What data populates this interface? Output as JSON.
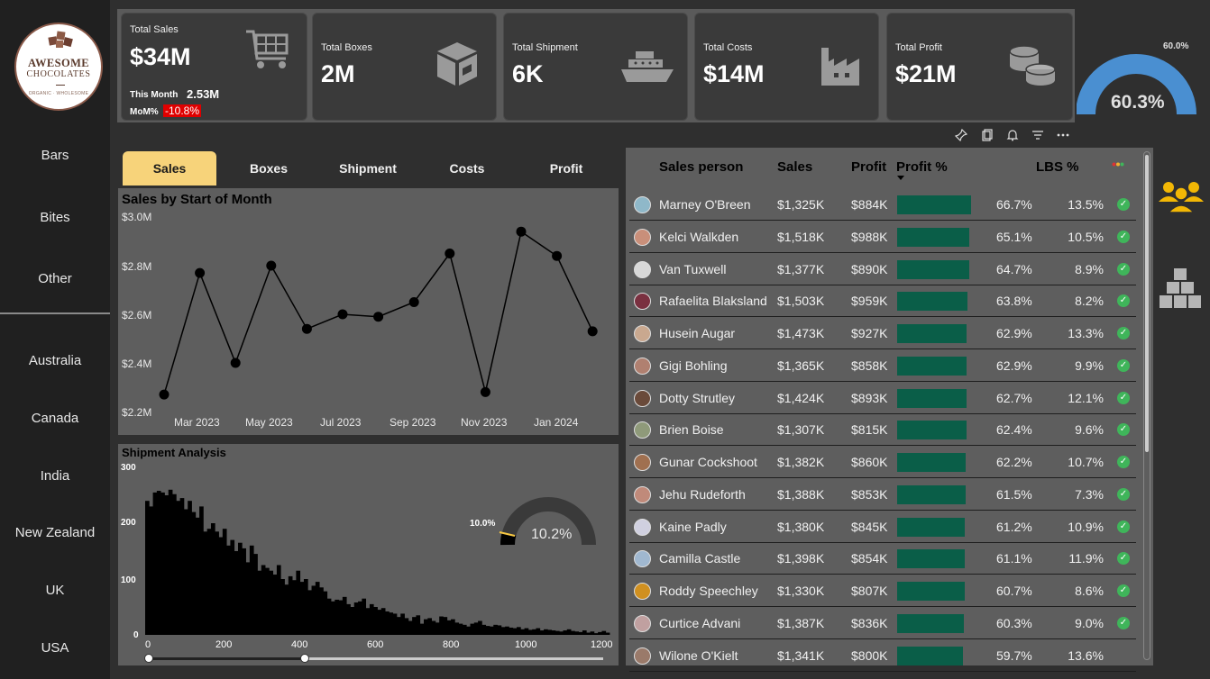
{
  "logo": {
    "line1": "AWESOME",
    "line2": "CHOCOLATES",
    "line3": "ORGANIC · WHOLESOME"
  },
  "sidebar": {
    "products": [
      "Bars",
      "Bites",
      "Other"
    ],
    "countries": [
      "Australia",
      "Canada",
      "India",
      "New Zealand",
      "UK",
      "USA"
    ]
  },
  "kpis": {
    "sales": {
      "title": "Total Sales",
      "value": "$34M",
      "this_month_label": "This Month",
      "this_month_value": "2.53M",
      "mom_label": "MoM%",
      "mom_value": "-10.8%"
    },
    "boxes": {
      "title": "Total Boxes",
      "value": "2M"
    },
    "shipment": {
      "title": "Total Shipment",
      "value": "6K"
    },
    "costs": {
      "title": "Total Costs",
      "value": "$14M"
    },
    "profit": {
      "title": "Total Profit",
      "value": "$21M"
    }
  },
  "profit_gauge": {
    "target_label": "60.0%",
    "value_label": "60.3%",
    "value": 60.3,
    "target": 60.0,
    "color": "#4a8fd1"
  },
  "tabs": [
    "Sales",
    "Boxes",
    "Shipment",
    "Costs",
    "Profit"
  ],
  "active_tab": "Sales",
  "line_chart": {
    "title": "Sales by Start of Month",
    "y_ticks": [
      "$3.0M",
      "$2.8M",
      "$2.6M",
      "$2.4M",
      "$2.2M"
    ],
    "x_ticks": [
      "Mar 2023",
      "May 2023",
      "Jul 2023",
      "Sep 2023",
      "Nov 2023",
      "Jan 2024"
    ]
  },
  "shipment_chart": {
    "title": "Shipment Analysis",
    "y_ticks": [
      "300",
      "200",
      "100",
      "0"
    ],
    "x_ticks": [
      "0",
      "200",
      "400",
      "600",
      "800",
      "1000",
      "1200"
    ],
    "gauge_target_label": "10.0%",
    "gauge_value_label": "10.2%"
  },
  "chart_data": [
    {
      "type": "line",
      "title": "Sales by Start of Month",
      "x": [
        "2023-02",
        "2023-03",
        "2023-04",
        "2023-05",
        "2023-06",
        "2023-07",
        "2023-08",
        "2023-09",
        "2023-10",
        "2023-11",
        "2023-12",
        "2024-01",
        "2024-02"
      ],
      "y": [
        2.27,
        2.77,
        2.4,
        2.8,
        2.54,
        2.6,
        2.59,
        2.65,
        2.85,
        2.28,
        2.94,
        2.84,
        2.53
      ],
      "ylim": [
        2.2,
        3.0
      ],
      "y_unit": "$M",
      "color": "#000000"
    },
    {
      "type": "bar",
      "title": "Shipment Analysis",
      "bin_width": 10,
      "x_range": [
        0,
        1200
      ],
      "ylim": [
        0,
        300
      ],
      "values": [
        240,
        230,
        255,
        258,
        255,
        250,
        260,
        252,
        240,
        245,
        225,
        240,
        220,
        210,
        230,
        185,
        190,
        200,
        185,
        175,
        190,
        160,
        170,
        150,
        165,
        155,
        130,
        160,
        145,
        115,
        125,
        120,
        115,
        108,
        125,
        100,
        90,
        105,
        98,
        115,
        95,
        100,
        80,
        88,
        95,
        85,
        78,
        65,
        60,
        63,
        62,
        68,
        55,
        50,
        58,
        60,
        65,
        48,
        55,
        50,
        45,
        48,
        42,
        40,
        38,
        32,
        38,
        30,
        25,
        32,
        35,
        20,
        28,
        30,
        25,
        22,
        33,
        32,
        26,
        28,
        22,
        20,
        18,
        15,
        20,
        22,
        25,
        18,
        16,
        15,
        18,
        17,
        14,
        15,
        13,
        12,
        14,
        10,
        12,
        9,
        10,
        12,
        8,
        10,
        9,
        8,
        7,
        6,
        8,
        10,
        7,
        6,
        5,
        8,
        4,
        6,
        3,
        5,
        7,
        4
      ],
      "color": "#000000"
    },
    {
      "type": "table",
      "columns": [
        "Sales person",
        "Sales",
        "Profit",
        "Profit %",
        "LBS %"
      ],
      "rows": [
        [
          "Marney O'Breen",
          "$1,325K",
          "$884K",
          "66.7%",
          "13.5%"
        ],
        [
          "Kelci Walkden",
          "$1,518K",
          "$988K",
          "65.1%",
          "10.5%"
        ],
        [
          "Van Tuxwell",
          "$1,377K",
          "$890K",
          "64.7%",
          "8.9%"
        ],
        [
          "Rafaelita Blaksland",
          "$1,503K",
          "$959K",
          "63.8%",
          "8.2%"
        ],
        [
          "Husein Augar",
          "$1,473K",
          "$927K",
          "62.9%",
          "13.3%"
        ],
        [
          "Gigi Bohling",
          "$1,365K",
          "$858K",
          "62.9%",
          "9.9%"
        ],
        [
          "Dotty Strutley",
          "$1,424K",
          "$893K",
          "62.7%",
          "12.1%"
        ],
        [
          "Brien Boise",
          "$1,307K",
          "$815K",
          "62.4%",
          "9.6%"
        ],
        [
          "Gunar Cockshoot",
          "$1,382K",
          "$860K",
          "62.2%",
          "10.7%"
        ],
        [
          "Jehu Rudeforth",
          "$1,388K",
          "$853K",
          "61.5%",
          "7.3%"
        ],
        [
          "Kaine Padly",
          "$1,380K",
          "$845K",
          "61.2%",
          "10.9%"
        ],
        [
          "Camilla Castle",
          "$1,398K",
          "$854K",
          "61.1%",
          "11.9%"
        ],
        [
          "Roddy Speechley",
          "$1,330K",
          "$807K",
          "60.7%",
          "8.6%"
        ],
        [
          "Curtice Advani",
          "$1,387K",
          "$836K",
          "60.3%",
          "9.0%"
        ],
        [
          "Wilone O'Kielt",
          "$1,341K",
          "$800K",
          "59.7%",
          "13.6%"
        ]
      ]
    }
  ],
  "table": {
    "headers": {
      "person": "Sales person",
      "sales": "Sales",
      "profit": "Profit",
      "profit_pct": "Profit %",
      "lbs": "LBS %"
    },
    "bar_color": "#0a5e48",
    "check_color": "#3fb55a",
    "avatar_colors": [
      "#8fb8c9",
      "#c98f7a",
      "#d8d8d8",
      "#7a3040",
      "#c9a88f",
      "#b08070",
      "#6a4a3a",
      "#8f9a7a",
      "#a07050",
      "#c08a7a",
      "#d0d0e0",
      "#a0b8d0",
      "#d09020",
      "#c0a0a0",
      "#9a7a6a"
    ]
  },
  "accent": {
    "tab_active": "#f7d37a",
    "icon_gold": "#f2b705",
    "mom_bg": "#e00000"
  }
}
